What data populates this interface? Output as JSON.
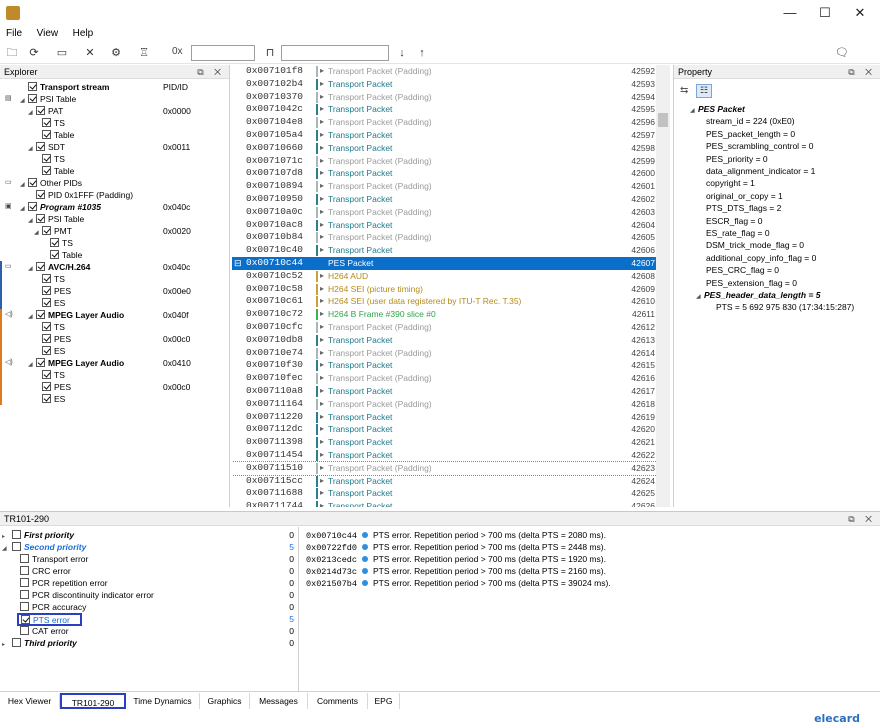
{
  "window": {
    "minimize": "—",
    "maximize": "☐",
    "close": "✕"
  },
  "menu": [
    "File",
    "View",
    "Help"
  ],
  "toolbar": {
    "hex_prefix": "0x"
  },
  "explorer": {
    "title": "Explorer",
    "header_pid": "PID/ID",
    "rows": [
      {
        "label": "Transport stream",
        "pid": "",
        "indent": 28,
        "bold": true
      },
      {
        "label": "PSI Table",
        "pid": "",
        "indent": 28
      },
      {
        "label": "PAT",
        "pid": "0x0000",
        "indent": 36
      },
      {
        "label": "TS",
        "pid": "",
        "indent": 42
      },
      {
        "label": "Table",
        "pid": "",
        "indent": 42
      },
      {
        "label": "SDT",
        "pid": "0x0011",
        "indent": 36
      },
      {
        "label": "TS",
        "pid": "",
        "indent": 42
      },
      {
        "label": "Table",
        "pid": "",
        "indent": 42
      },
      {
        "label": "Other PIDs",
        "pid": "",
        "indent": 28
      },
      {
        "label": "PID 0x1FFF (Padding)",
        "pid": "",
        "indent": 36
      },
      {
        "label": "Program #1035",
        "pid": "0x040c",
        "indent": 28,
        "bold": true,
        "italic": true
      },
      {
        "label": "PSI Table",
        "pid": "",
        "indent": 36
      },
      {
        "label": "PMT",
        "pid": "0x0020",
        "indent": 42
      },
      {
        "label": "TS",
        "pid": "",
        "indent": 50
      },
      {
        "label": "Table",
        "pid": "",
        "indent": 50
      },
      {
        "label": "AVC/H.264",
        "pid": "0x040c",
        "indent": 36,
        "bold": true
      },
      {
        "label": "TS",
        "pid": "",
        "indent": 42
      },
      {
        "label": "PES",
        "pid": "0x00e0",
        "indent": 42
      },
      {
        "label": "ES",
        "pid": "",
        "indent": 42
      },
      {
        "label": "MPEG Layer Audio",
        "pid": "0x040f",
        "indent": 36,
        "bold": true
      },
      {
        "label": "TS",
        "pid": "",
        "indent": 42
      },
      {
        "label": "PES",
        "pid": "0x00c0",
        "indent": 42
      },
      {
        "label": "ES",
        "pid": "",
        "indent": 42
      },
      {
        "label": "MPEG Layer Audio",
        "pid": "0x0410",
        "indent": 36,
        "bold": true
      },
      {
        "label": "TS",
        "pid": "",
        "indent": 42
      },
      {
        "label": "PES",
        "pid": "0x00c0",
        "indent": 42
      },
      {
        "label": "ES",
        "pid": "",
        "indent": 42
      }
    ]
  },
  "packets": [
    {
      "off": "0x007101f8",
      "type": "Transport Packet (Padding)",
      "num": "42592",
      "kind": "pad"
    },
    {
      "off": "0x007102b4",
      "type": "Transport Packet",
      "num": "42593",
      "kind": "ts"
    },
    {
      "off": "0x00710370",
      "type": "Transport Packet (Padding)",
      "num": "42594",
      "kind": "pad"
    },
    {
      "off": "0x0071042c",
      "type": "Transport Packet",
      "num": "42595",
      "kind": "ts"
    },
    {
      "off": "0x007104e8",
      "type": "Transport Packet (Padding)",
      "num": "42596",
      "kind": "pad"
    },
    {
      "off": "0x007105a4",
      "type": "Transport Packet",
      "num": "42597",
      "kind": "ts"
    },
    {
      "off": "0x00710660",
      "type": "Transport Packet",
      "num": "42598",
      "kind": "ts"
    },
    {
      "off": "0x0071071c",
      "type": "Transport Packet (Padding)",
      "num": "42599",
      "kind": "pad"
    },
    {
      "off": "0x007107d8",
      "type": "Transport Packet",
      "num": "42600",
      "kind": "ts"
    },
    {
      "off": "0x00710894",
      "type": "Transport Packet (Padding)",
      "num": "42601",
      "kind": "pad"
    },
    {
      "off": "0x00710950",
      "type": "Transport Packet",
      "num": "42602",
      "kind": "ts"
    },
    {
      "off": "0x00710a0c",
      "type": "Transport Packet (Padding)",
      "num": "42603",
      "kind": "pad"
    },
    {
      "off": "0x00710ac8",
      "type": "Transport Packet",
      "num": "42604",
      "kind": "ts"
    },
    {
      "off": "0x00710b84",
      "type": "Transport Packet (Padding)",
      "num": "42605",
      "kind": "pad"
    },
    {
      "off": "0x00710c40",
      "type": "Transport Packet",
      "num": "42606",
      "kind": "ts"
    },
    {
      "off": "0x00710c44",
      "type": "PES Packet",
      "num": "42607",
      "kind": "sel"
    },
    {
      "off": "0x00710c52",
      "type": "H264 AUD",
      "num": "42608",
      "kind": "h264"
    },
    {
      "off": "0x00710c58",
      "type": "H264 SEI (picture timing)",
      "num": "42609",
      "kind": "h264"
    },
    {
      "off": "0x00710c61",
      "type": "H264 SEI (user data registered by ITU-T Rec. T.35)",
      "num": "42610",
      "kind": "h264"
    },
    {
      "off": "0x00710c72",
      "type": "H264 B Frame #390 slice #0",
      "num": "42611",
      "kind": "frame"
    },
    {
      "off": "0x00710cfc",
      "type": "Transport Packet (Padding)",
      "num": "42612",
      "kind": "pad"
    },
    {
      "off": "0x00710db8",
      "type": "Transport Packet",
      "num": "42613",
      "kind": "ts"
    },
    {
      "off": "0x00710e74",
      "type": "Transport Packet (Padding)",
      "num": "42614",
      "kind": "pad"
    },
    {
      "off": "0x00710f30",
      "type": "Transport Packet",
      "num": "42615",
      "kind": "ts"
    },
    {
      "off": "0x00710fec",
      "type": "Transport Packet (Padding)",
      "num": "42616",
      "kind": "pad"
    },
    {
      "off": "0x007110a8",
      "type": "Transport Packet",
      "num": "42617",
      "kind": "ts"
    },
    {
      "off": "0x00711164",
      "type": "Transport Packet (Padding)",
      "num": "42618",
      "kind": "pad"
    },
    {
      "off": "0x00711220",
      "type": "Transport Packet",
      "num": "42619",
      "kind": "ts"
    },
    {
      "off": "0x007112dc",
      "type": "Transport Packet",
      "num": "42620",
      "kind": "ts"
    },
    {
      "off": "0x00711398",
      "type": "Transport Packet",
      "num": "42621",
      "kind": "ts"
    },
    {
      "off": "0x00711454",
      "type": "Transport Packet",
      "num": "42622",
      "kind": "ts"
    },
    {
      "off": "0x00711510",
      "type": "Transport Packet (Padding)",
      "num": "42623",
      "kind": "boxed"
    },
    {
      "off": "0x007115cc",
      "type": "Transport Packet",
      "num": "42624",
      "kind": "ts"
    },
    {
      "off": "0x00711688",
      "type": "Transport Packet",
      "num": "42625",
      "kind": "ts"
    },
    {
      "off": "0x00711744",
      "type": "Transport Packet",
      "num": "42626",
      "kind": "ts"
    }
  ],
  "property": {
    "title": "Property",
    "rows": [
      {
        "text": "PES Packet",
        "indent": 26,
        "bi": true,
        "tri": true
      },
      {
        "text": "stream_id = 224 (0xE0)",
        "indent": 32
      },
      {
        "text": "PES_packet_length = 0",
        "indent": 32
      },
      {
        "text": "PES_scrambling_control = 0",
        "indent": 32
      },
      {
        "text": "PES_priority = 0",
        "indent": 32
      },
      {
        "text": "data_alignment_indicator = 1",
        "indent": 32
      },
      {
        "text": "copyright = 1",
        "indent": 32
      },
      {
        "text": "original_or_copy = 1",
        "indent": 32
      },
      {
        "text": "PTS_DTS_flags = 2",
        "indent": 32
      },
      {
        "text": "ESCR_flag = 0",
        "indent": 32
      },
      {
        "text": "ES_rate_flag = 0",
        "indent": 32
      },
      {
        "text": "DSM_trick_mode_flag = 0",
        "indent": 32
      },
      {
        "text": "additional_copy_info_flag = 0",
        "indent": 32
      },
      {
        "text": "PES_CRC_flag = 0",
        "indent": 32
      },
      {
        "text": "PES_extension_flag = 0",
        "indent": 32
      },
      {
        "text": "PES_header_data_length = 5",
        "indent": 32,
        "bi": true,
        "tri": true
      },
      {
        "text": "PTS = 5 692 975 830 (17:34:15:287)",
        "indent": 42
      }
    ]
  },
  "tr101": {
    "title": "TR101-290",
    "rows": [
      {
        "label": "First priority",
        "count": "0",
        "indent": 4,
        "bi": true,
        "tri": true
      },
      {
        "label": "Second priority",
        "count": "5",
        "indent": 4,
        "bi": true,
        "tri": true,
        "blue": true
      },
      {
        "label": "Transport error",
        "count": "0",
        "indent": 18
      },
      {
        "label": "CRC error",
        "count": "0",
        "indent": 18
      },
      {
        "label": "PCR repetition error",
        "count": "0",
        "indent": 18
      },
      {
        "label": "PCR discontinuity indicator error",
        "count": "0",
        "indent": 18
      },
      {
        "label": "PCR accuracy",
        "count": "0",
        "indent": 18
      },
      {
        "label": "PTS error",
        "count": "5",
        "indent": 18,
        "checked": true,
        "blue": true,
        "boxed": true
      },
      {
        "label": "CAT error",
        "count": "0",
        "indent": 18
      },
      {
        "label": "Third priority",
        "count": "0",
        "indent": 4,
        "bi": true,
        "tri": true
      }
    ],
    "log": [
      {
        "off": "0x00710c44",
        "msg": "PTS error. Repetition period > 700 ms (delta PTS = 2080 ms)."
      },
      {
        "off": "0x00722fd0",
        "msg": "PTS error. Repetition period > 700 ms (delta PTS = 2448 ms)."
      },
      {
        "off": "0x0213cedc",
        "msg": "PTS error. Repetition period > 700 ms (delta PTS = 1920 ms)."
      },
      {
        "off": "0x0214d73c",
        "msg": "PTS error. Repetition period > 700 ms (delta PTS = 2160 ms)."
      },
      {
        "off": "0x021507b4",
        "msg": "PTS error. Repetition period > 700 ms (delta PTS = 39024 ms)."
      }
    ]
  },
  "tabs": [
    "Hex Viewer",
    "TR101-290",
    "Time Dynamics",
    "Graphics",
    "Messages",
    "Comments",
    "EPG"
  ],
  "logo": "elecard",
  "colors": {
    "selection": "#0b6fc9",
    "padding": "#9a9a9a",
    "ts": "#1d7a8a",
    "h264": "#b58a1a",
    "frame": "#2ea44a",
    "blue_text": "#1a6ed8"
  }
}
